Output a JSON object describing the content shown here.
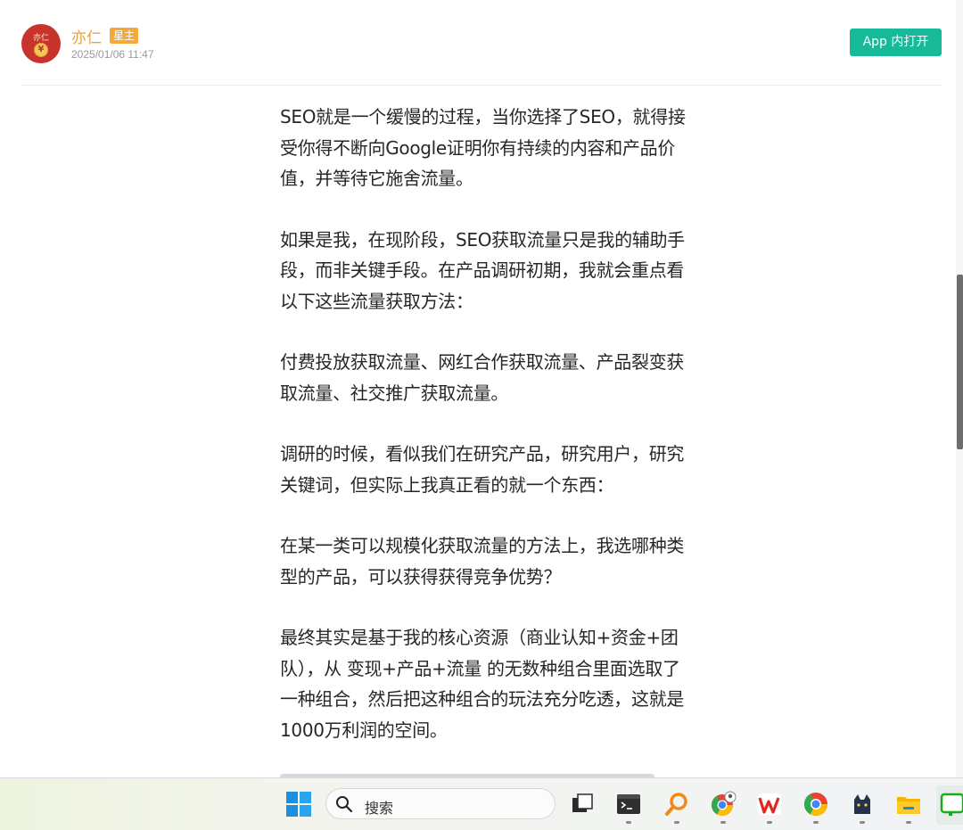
{
  "post": {
    "author": {
      "avatar_text": "亦仁",
      "name": "亦仁",
      "badge": "星主",
      "timestamp": "2025/01/06 11:47"
    },
    "open_in_app_label": "App 内打开",
    "paragraphs": [
      "SEO就是一个缓慢的过程，当你选择了SEO，就得接受你得不断向Google证明你有持续的内容和产品价值，并等待它施舍流量。",
      "如果是我，在现阶段，SEO获取流量只是我的辅助手段，而非关键手段。在产品调研初期，我就会重点看以下这些流量获取方法：",
      "付费投放获取流量、网红合作获取流量、产品裂变获取流量、社交推广获取流量。",
      "调研的时候，看似我们在研究产品，研究用户，研究关键词，但实际上我真正看的就一个东西：",
      "在某一类可以规模化获取流量的方法上，我选哪种类型的产品，可以获得获得竞争优势？",
      "最终其实是基于我的核心资源（商业认知+资金+团队），从 变现+产品+流量 的无数种组合里面选取了一种组合，然后把这种组合的玩法充分吃透，这就是1000万利润的空间。"
    ]
  },
  "taskbar": {
    "search_label": "搜索",
    "icons": [
      "windows-start-icon",
      "task-view-icon",
      "terminal-icon",
      "magnifier-app-icon",
      "chrome-profile-icon",
      "wps-office-icon",
      "chrome-icon",
      "cat-app-icon",
      "file-explorer-icon",
      "wechat-icon"
    ]
  },
  "colors": {
    "accent_green": "#16b998",
    "author_orange": "#e9a13c",
    "badge_orange": "#f5a93b",
    "avatar_red": "#c8342b"
  }
}
